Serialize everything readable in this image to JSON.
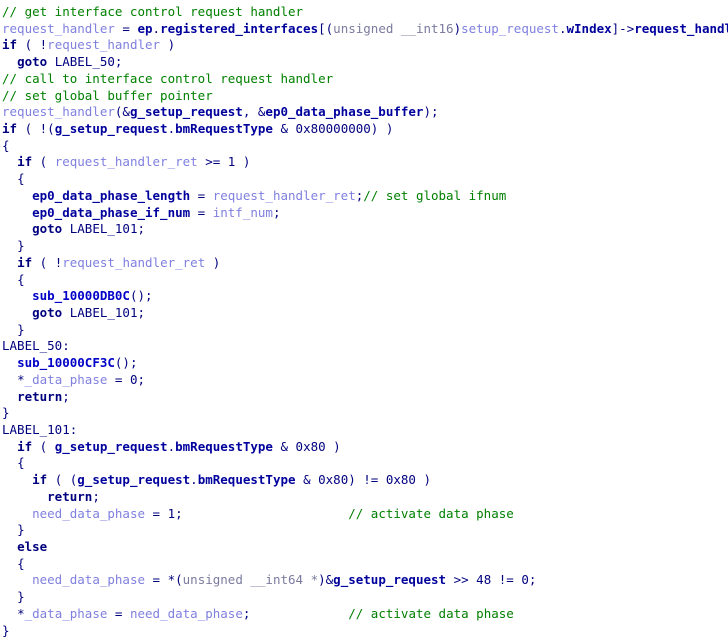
{
  "view": {
    "kind": "decompiler-pseudocode-listing",
    "language": "c",
    "background": "#ffffff",
    "colors": {
      "comment": "#008000",
      "local_variable": "#8080e0",
      "global_variable": "#00009d",
      "function_call": "#0000c8",
      "type_cast": "#7b7b9e",
      "punctuation": "#00007f",
      "keyword": "#00007f"
    }
  },
  "code": {
    "lines": [
      {
        "id": "line-1",
        "indent": 0,
        "tokens": [
          {
            "t": "comment",
            "v": "// get interface control request handler"
          }
        ]
      },
      {
        "id": "line-2",
        "indent": 0,
        "tokens": [
          {
            "t": "local",
            "v": "request_handler"
          },
          {
            "t": "punct",
            "v": " = "
          },
          {
            "t": "global",
            "v": "ep"
          },
          {
            "t": "punct",
            "v": "."
          },
          {
            "t": "global",
            "v": "registered_interfaces"
          },
          {
            "t": "punct",
            "v": "[("
          },
          {
            "t": "cast",
            "v": "unsigned __int16"
          },
          {
            "t": "punct",
            "v": ")"
          },
          {
            "t": "local",
            "v": "setup_request"
          },
          {
            "t": "punct",
            "v": "."
          },
          {
            "t": "member",
            "v": "wIndex"
          },
          {
            "t": "punct",
            "v": "]->"
          },
          {
            "t": "global",
            "v": "request_handler"
          },
          {
            "t": "punct",
            "v": ";"
          }
        ]
      },
      {
        "id": "line-3",
        "indent": 0,
        "tokens": [
          {
            "t": "kw",
            "v": "if"
          },
          {
            "t": "punct",
            "v": " ( !"
          },
          {
            "t": "local",
            "v": "request_handler"
          },
          {
            "t": "punct",
            "v": " )"
          }
        ]
      },
      {
        "id": "line-4",
        "indent": 1,
        "tokens": [
          {
            "t": "kw",
            "v": "goto"
          },
          {
            "t": "punct",
            "v": " "
          },
          {
            "t": "label",
            "v": "LABEL_50"
          },
          {
            "t": "punct",
            "v": ";"
          }
        ]
      },
      {
        "id": "line-5",
        "indent": 0,
        "tokens": [
          {
            "t": "comment",
            "v": "// call to interface control request handler"
          }
        ]
      },
      {
        "id": "line-6",
        "indent": 0,
        "tokens": [
          {
            "t": "comment",
            "v": "// set global buffer pointer"
          }
        ]
      },
      {
        "id": "line-7",
        "indent": 0,
        "tokens": [
          {
            "t": "local",
            "v": "request_handler"
          },
          {
            "t": "punct",
            "v": "(&"
          },
          {
            "t": "global",
            "v": "g_setup_request"
          },
          {
            "t": "punct",
            "v": ", &"
          },
          {
            "t": "global",
            "v": "ep0_data_phase_buffer"
          },
          {
            "t": "punct",
            "v": ");"
          }
        ]
      },
      {
        "id": "line-8",
        "indent": 0,
        "tokens": [
          {
            "t": "kw",
            "v": "if"
          },
          {
            "t": "punct",
            "v": " ( !("
          },
          {
            "t": "global",
            "v": "g_setup_request"
          },
          {
            "t": "punct",
            "v": "."
          },
          {
            "t": "member",
            "v": "bmRequestType"
          },
          {
            "t": "punct",
            "v": " & 0x80000000) )"
          }
        ]
      },
      {
        "id": "line-9",
        "indent": 0,
        "tokens": [
          {
            "t": "punct",
            "v": "{"
          }
        ]
      },
      {
        "id": "line-10",
        "indent": 1,
        "tokens": [
          {
            "t": "kw",
            "v": "if"
          },
          {
            "t": "punct",
            "v": " ( "
          },
          {
            "t": "local",
            "v": "request_handler_ret"
          },
          {
            "t": "punct",
            "v": " >= 1 )"
          }
        ]
      },
      {
        "id": "line-11",
        "indent": 1,
        "tokens": [
          {
            "t": "punct",
            "v": "{"
          }
        ]
      },
      {
        "id": "line-12",
        "indent": 2,
        "tokens": [
          {
            "t": "global",
            "v": "ep0_data_phase_length"
          },
          {
            "t": "punct",
            "v": " = "
          },
          {
            "t": "local",
            "v": "request_handler_ret"
          },
          {
            "t": "punct",
            "v": ";"
          },
          {
            "t": "comment",
            "v": "// set global ifnum"
          }
        ]
      },
      {
        "id": "line-13",
        "indent": 2,
        "tokens": [
          {
            "t": "global",
            "v": "ep0_data_phase_if_num"
          },
          {
            "t": "punct",
            "v": " = "
          },
          {
            "t": "local",
            "v": "intf_num"
          },
          {
            "t": "punct",
            "v": ";"
          }
        ]
      },
      {
        "id": "line-14",
        "indent": 2,
        "tokens": [
          {
            "t": "kw",
            "v": "goto"
          },
          {
            "t": "punct",
            "v": " "
          },
          {
            "t": "label",
            "v": "LABEL_101"
          },
          {
            "t": "punct",
            "v": ";"
          }
        ]
      },
      {
        "id": "line-15",
        "indent": 1,
        "tokens": [
          {
            "t": "punct",
            "v": "}"
          }
        ]
      },
      {
        "id": "line-16",
        "indent": 1,
        "tokens": [
          {
            "t": "kw",
            "v": "if"
          },
          {
            "t": "punct",
            "v": " ( !"
          },
          {
            "t": "local",
            "v": "request_handler_ret"
          },
          {
            "t": "punct",
            "v": " )"
          }
        ]
      },
      {
        "id": "line-17",
        "indent": 1,
        "tokens": [
          {
            "t": "punct",
            "v": "{"
          }
        ]
      },
      {
        "id": "line-18",
        "indent": 2,
        "tokens": [
          {
            "t": "func",
            "v": "sub_10000DB0C"
          },
          {
            "t": "punct",
            "v": "();"
          }
        ]
      },
      {
        "id": "line-19",
        "indent": 2,
        "tokens": [
          {
            "t": "kw",
            "v": "goto"
          },
          {
            "t": "punct",
            "v": " "
          },
          {
            "t": "label",
            "v": "LABEL_101"
          },
          {
            "t": "punct",
            "v": ";"
          }
        ]
      },
      {
        "id": "line-20",
        "indent": 1,
        "tokens": [
          {
            "t": "punct",
            "v": "}"
          }
        ]
      },
      {
        "id": "line-21",
        "indent": -1,
        "tokens": [
          {
            "t": "label",
            "v": "LABEL_50"
          },
          {
            "t": "punct",
            "v": ":"
          }
        ]
      },
      {
        "id": "line-22",
        "indent": 1,
        "tokens": [
          {
            "t": "func",
            "v": "sub_10000CF3C"
          },
          {
            "t": "punct",
            "v": "();"
          }
        ]
      },
      {
        "id": "line-23",
        "indent": 1,
        "tokens": [
          {
            "t": "punct",
            "v": "*"
          },
          {
            "t": "local",
            "v": "_data_phase"
          },
          {
            "t": "punct",
            "v": " = 0;"
          }
        ]
      },
      {
        "id": "line-24",
        "indent": 1,
        "tokens": [
          {
            "t": "kw",
            "v": "return"
          },
          {
            "t": "punct",
            "v": ";"
          }
        ]
      },
      {
        "id": "line-25",
        "indent": 0,
        "tokens": [
          {
            "t": "punct",
            "v": "}"
          }
        ]
      },
      {
        "id": "line-26",
        "indent": -1,
        "tokens": [
          {
            "t": "label",
            "v": "LABEL_101"
          },
          {
            "t": "punct",
            "v": ":"
          }
        ]
      },
      {
        "id": "line-27",
        "indent": 1,
        "tokens": [
          {
            "t": "kw",
            "v": "if"
          },
          {
            "t": "punct",
            "v": " ( "
          },
          {
            "t": "global",
            "v": "g_setup_request"
          },
          {
            "t": "punct",
            "v": "."
          },
          {
            "t": "member",
            "v": "bmRequestType"
          },
          {
            "t": "punct",
            "v": " & 0x80 )"
          }
        ]
      },
      {
        "id": "line-28",
        "indent": 1,
        "tokens": [
          {
            "t": "punct",
            "v": "{"
          }
        ]
      },
      {
        "id": "line-29",
        "indent": 2,
        "tokens": [
          {
            "t": "kw",
            "v": "if"
          },
          {
            "t": "punct",
            "v": " ( ("
          },
          {
            "t": "global",
            "v": "g_setup_request"
          },
          {
            "t": "punct",
            "v": "."
          },
          {
            "t": "member",
            "v": "bmRequestType"
          },
          {
            "t": "punct",
            "v": " & 0x80) != 0x80 )"
          }
        ]
      },
      {
        "id": "line-30",
        "indent": 3,
        "tokens": [
          {
            "t": "kw",
            "v": "return"
          },
          {
            "t": "punct",
            "v": ";"
          }
        ]
      },
      {
        "id": "line-31",
        "indent": 2,
        "tokens": [
          {
            "t": "local",
            "v": "need_data_phase"
          },
          {
            "t": "punct",
            "v": " = 1;"
          }
        ],
        "trailing_comment": {
          "column": 46,
          "text": "// activate data phase"
        }
      },
      {
        "id": "line-32",
        "indent": 1,
        "tokens": [
          {
            "t": "punct",
            "v": "}"
          }
        ]
      },
      {
        "id": "line-33",
        "indent": 1,
        "tokens": [
          {
            "t": "kw",
            "v": "else"
          }
        ]
      },
      {
        "id": "line-34",
        "indent": 1,
        "tokens": [
          {
            "t": "punct",
            "v": "{"
          }
        ]
      },
      {
        "id": "line-35",
        "indent": 2,
        "tokens": [
          {
            "t": "local",
            "v": "need_data_phase"
          },
          {
            "t": "punct",
            "v": " = *("
          },
          {
            "t": "cast",
            "v": "unsigned __int64 *"
          },
          {
            "t": "punct",
            "v": ")&"
          },
          {
            "t": "global",
            "v": "g_setup_request"
          },
          {
            "t": "punct",
            "v": " >> 48 != 0;"
          }
        ]
      },
      {
        "id": "line-36",
        "indent": 1,
        "tokens": [
          {
            "t": "punct",
            "v": "}"
          }
        ]
      },
      {
        "id": "line-37",
        "indent": 1,
        "tokens": [
          {
            "t": "punct",
            "v": "*"
          },
          {
            "t": "local",
            "v": "_data_phase"
          },
          {
            "t": "punct",
            "v": " = "
          },
          {
            "t": "local",
            "v": "need_data_phase"
          },
          {
            "t": "punct",
            "v": ";"
          }
        ],
        "trailing_comment": {
          "column": 46,
          "text": "// activate data phase"
        }
      },
      {
        "id": "line-38",
        "indent": 0,
        "tokens": [
          {
            "t": "punct",
            "v": "}"
          }
        ]
      }
    ]
  }
}
